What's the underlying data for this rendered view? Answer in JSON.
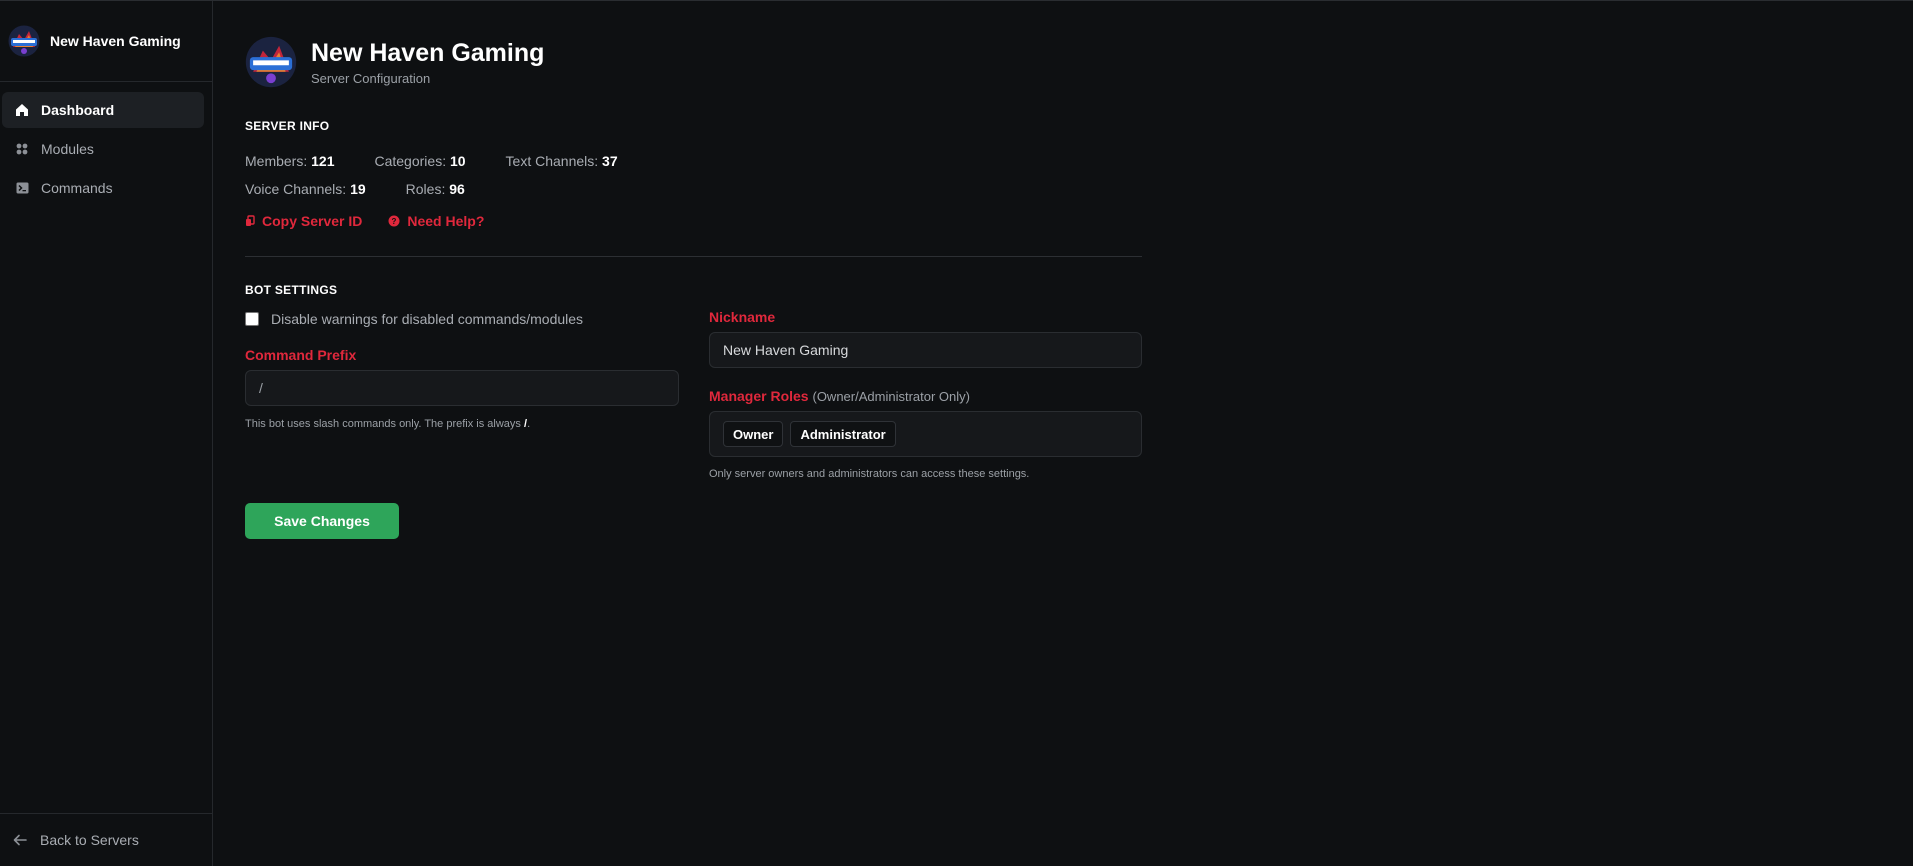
{
  "sidebar": {
    "brand_name": "New Haven Gaming",
    "items": [
      {
        "label": "Dashboard",
        "icon": "home-icon",
        "active": true
      },
      {
        "label": "Modules",
        "icon": "grid-icon",
        "active": false
      },
      {
        "label": "Commands",
        "icon": "terminal-icon",
        "active": false
      }
    ],
    "footer_label": "Back to Servers"
  },
  "header": {
    "title": "New Haven Gaming",
    "subtitle": "Server Configuration"
  },
  "server_info": {
    "title": "SERVER INFO",
    "stats": {
      "members_label": "Members:",
      "members": "121",
      "categories_label": "Categories:",
      "categories": "10",
      "text_channels_label": "Text Channels:",
      "text_channels": "37",
      "voice_channels_label": "Voice Channels:",
      "voice_channels": "19",
      "roles_label": "Roles:",
      "roles": "96"
    },
    "copy_id_label": "Copy Server ID",
    "help_label": "Need Help?"
  },
  "bot_settings": {
    "title": "BOT SETTINGS",
    "disable_warnings_label": "Disable warnings for disabled commands/modules",
    "disable_warnings_checked": false,
    "prefix_label": "Command Prefix",
    "prefix_value": "/",
    "prefix_help_text": "This bot uses slash commands only. The prefix is always",
    "prefix_help_value": "/",
    "prefix_help_end": ".",
    "nickname_label": "Nickname",
    "nickname_value": "New Haven Gaming",
    "manager_roles_label": "Manager Roles",
    "manager_roles_note": "(Owner/Administrator Only)",
    "manager_roles": [
      "Owner",
      "Administrator"
    ],
    "roles_help": "Only server owners and administrators can access these settings.",
    "save_label": "Save Changes"
  },
  "colors": {
    "accent": "#e0283c",
    "save": "#2ea55a",
    "background": "#0e1012"
  }
}
